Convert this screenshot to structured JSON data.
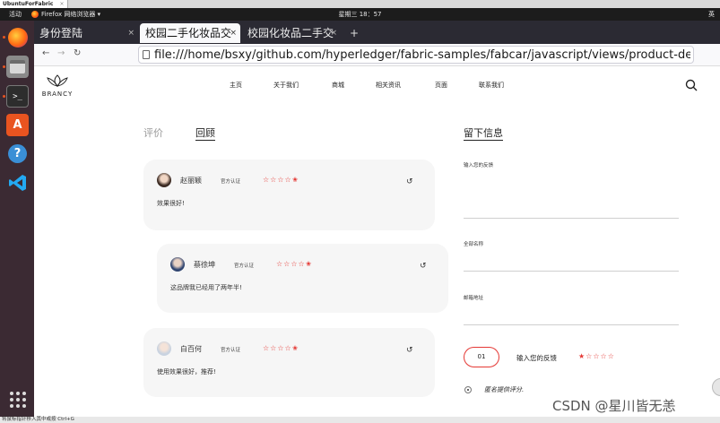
{
  "vm": {
    "tab_title": "UbuntuForFabric",
    "close": "×"
  },
  "topbar": {
    "activities": "活动",
    "app": "Firefox 网络浏览器 ▾",
    "clock": "星期三 18：57",
    "ime": "英"
  },
  "browser": {
    "tabs": [
      {
        "label": "身份登陆",
        "close": "×"
      },
      {
        "label": "校园二手化妆品交",
        "close": "×"
      },
      {
        "label": "校园化妆品二手交",
        "close": "×"
      }
    ],
    "new_tab": "+",
    "url": "file:///home/bsxy/github.com/hyperledger/fabric-samples/fabcar/javascript/views/product-details"
  },
  "site": {
    "logo_text": "BRANCY",
    "menu": [
      "主页",
      "关于我们",
      "商城",
      "相关资讯",
      "页面",
      "联系我们"
    ],
    "tabs": {
      "reviews": "评价",
      "replies": "回顾",
      "leave_info": "留下信息"
    },
    "comments": [
      {
        "name": "赵丽颖",
        "badge": "官方认证",
        "stars": "☆☆☆☆✬",
        "reply": "↺",
        "text": "效果很好!"
      },
      {
        "name": "蔡徐坤",
        "badge": "官方认证",
        "stars": "☆☆☆☆✬",
        "reply": "↺",
        "text": "这品牌我已经用了两年半!"
      },
      {
        "name": "白百何",
        "badge": "官方认证",
        "stars": "☆☆☆☆✬",
        "reply": "↺",
        "text": "使用效果很好，推荐!"
      }
    ],
    "form": {
      "feedback_label": "输入您的反馈",
      "name_label": "全部名称",
      "email_label": "邮箱地址",
      "submit_label": "01",
      "rating_label": "输入您的反馈",
      "rating_stars": "★☆☆☆☆",
      "anonymous_label": "匿名提供评分."
    },
    "watermark": "CSDN @星川皆无恙"
  },
  "status_text": "将鼠标指针移入其中或按 Ctrl+G"
}
